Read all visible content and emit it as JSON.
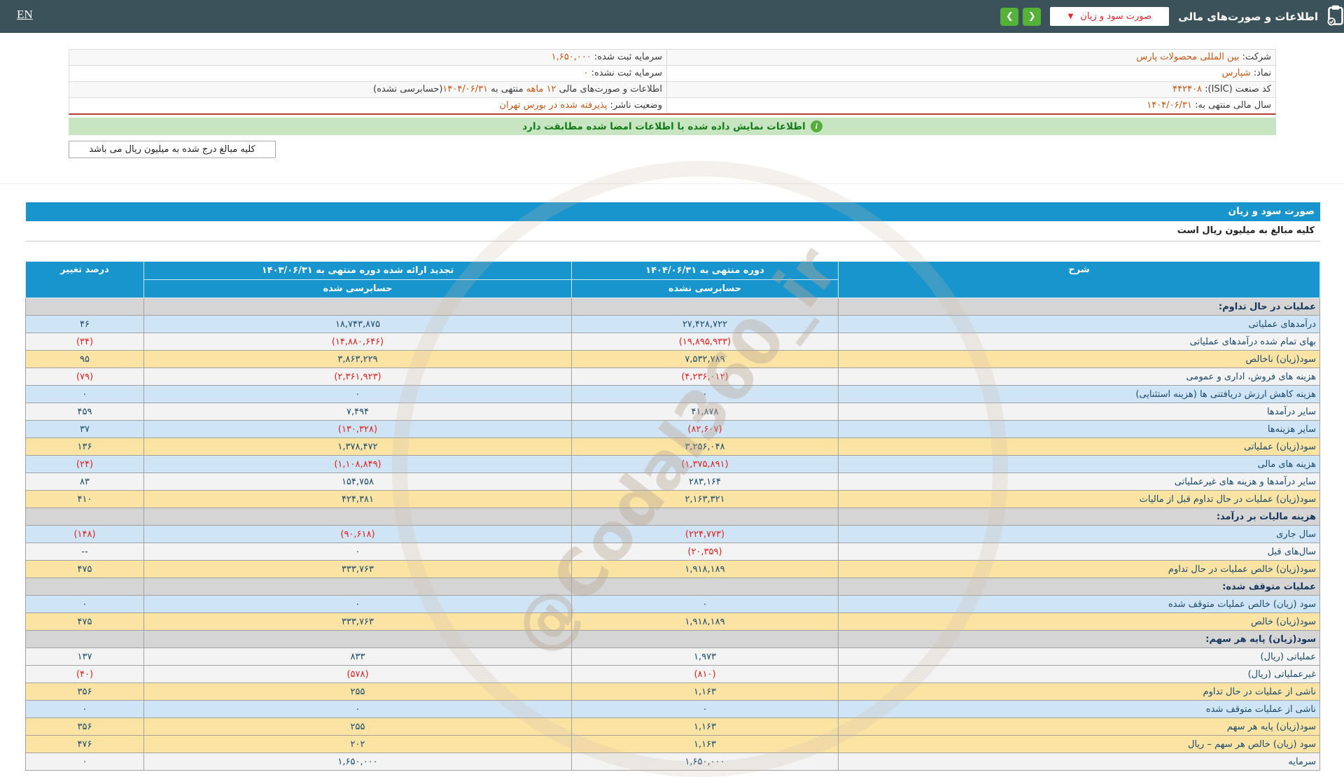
{
  "topbar": {
    "en": "EN",
    "title": "اطلاعات و صورت‌های مالی",
    "dropdown_value": "صورت سود و زیان",
    "dropdown_arrow": "▼",
    "next_icon": "❯",
    "prev_icon": "❮"
  },
  "company_info": {
    "rows": [
      {
        "right": [
          {
            "type": "label",
            "text": "شرکت: "
          },
          {
            "type": "value",
            "text": "بین المللی محصولات پارس"
          }
        ],
        "left": [
          {
            "type": "label",
            "text": "سرمایه ثبت شده: "
          },
          {
            "type": "value",
            "text": "۱,۶۵۰,۰۰۰"
          }
        ]
      },
      {
        "right": [
          {
            "type": "label",
            "text": "نماد: "
          },
          {
            "type": "value",
            "text": "شپارس"
          }
        ],
        "left": [
          {
            "type": "label",
            "text": "سرمایه ثبت نشده: "
          },
          {
            "type": "value",
            "text": "۰"
          }
        ]
      },
      {
        "right": [
          {
            "type": "label",
            "text": "کد صنعت (ISIC): "
          },
          {
            "type": "value",
            "text": "۴۴۲۴۰۸"
          }
        ],
        "left": [
          {
            "type": "label",
            "text": "اطلاعات و صورت‌های مالی "
          },
          {
            "type": "value",
            "text": "۱۲ ماهه"
          },
          {
            "type": "label",
            "text": " منتهی به "
          },
          {
            "type": "value",
            "text": "۱۴۰۴/۰۶/۳۱"
          },
          {
            "type": "label",
            "text": "(حسابرسی نشده)"
          }
        ]
      },
      {
        "right": [
          {
            "type": "label",
            "text": "سال مالی منتهی به: "
          },
          {
            "type": "value",
            "text": "۱۴۰۴/۰۶/۳۱"
          }
        ],
        "left": [
          {
            "type": "label",
            "text": "وضعیت ناشر: "
          },
          {
            "type": "value",
            "text": "پذیرفته شده در بورس تهران"
          }
        ]
      }
    ]
  },
  "banner": {
    "icon": "i",
    "text": "اطلاعات نمایش داده شده با اطلاعات امضا شده مطابقت دارد"
  },
  "units_note": "کلیه مبالغ درج شده به میلیون ریال می باشد",
  "statement": {
    "title": "صورت سود و زیان",
    "units_line": "کلیه مبالغ به میلیون ریال است",
    "columns": {
      "description": "شرح",
      "period_current": "دوره منتهی به ۱۴۰۴/۰۶/۳۱",
      "period_current_sub": "حسابرسی نشده",
      "period_prior": "تجدید ارائه شده دوره منتهی به ۱۴۰۳/۰۶/۳۱",
      "period_prior_sub": "حسابرسی شده",
      "change": "درصد تغییر"
    },
    "rows": [
      {
        "style": "section",
        "label": "عملیات در حال تداوم:",
        "current": "",
        "prior": "",
        "change": ""
      },
      {
        "style": "blue",
        "label": "درآمدهای عملیاتی",
        "current": "۲۷,۴۲۸,۷۲۲",
        "prior": "۱۸,۷۴۳,۸۷۵",
        "change": "۴۶"
      },
      {
        "style": "plain",
        "label": "بهای تمام شده درآمدهای عملیاتی",
        "current": "(۱۹,۸۹۵,۹۳۳)",
        "prior": "(۱۴,۸۸۰,۶۴۶)",
        "change": "(۳۴)"
      },
      {
        "style": "highlight",
        "label": "سود(زیان) ناخالص",
        "current": "۷,۵۳۲,۷۸۹",
        "prior": "۳,۸۶۳,۲۲۹",
        "change": "۹۵"
      },
      {
        "style": "plain",
        "label": "هزینه های فروش، اداری و عمومی",
        "current": "(۴,۲۳۶,۰۱۲)",
        "prior": "(۲,۳۶۱,۹۲۳)",
        "change": "(۷۹)"
      },
      {
        "style": "blue",
        "label": "هزینه کاهش ارزش دریافتنی ها (هزینه استثنایی)",
        "current": "۰",
        "prior": "۰",
        "change": "۰"
      },
      {
        "style": "plain",
        "label": "سایر درآمدها",
        "current": "۴۱,۸۷۸",
        "prior": "۷,۴۹۴",
        "change": "۴۵۹"
      },
      {
        "style": "blue",
        "label": "سایر هزینه‌ها",
        "current": "(۸۲,۶۰۷)",
        "prior": "(۱۳۰,۳۲۸)",
        "change": "۳۷"
      },
      {
        "style": "highlight",
        "label": "سود(زیان) عملیاتی",
        "current": "۳,۲۵۶,۰۴۸",
        "prior": "۱,۳۷۸,۴۷۲",
        "change": "۱۳۶"
      },
      {
        "style": "blue",
        "label": "هزینه های مالی",
        "current": "(۱,۳۷۵,۸۹۱)",
        "prior": "(۱,۱۰۸,۸۴۹)",
        "change": "(۲۴)"
      },
      {
        "style": "plain",
        "label": "سایر درآمدها و هزینه های غیرعملیاتی",
        "current": "۲۸۳,۱۶۴",
        "prior": "۱۵۴,۷۵۸",
        "change": "۸۳"
      },
      {
        "style": "highlight",
        "label": "سود(زیان) عملیات در حال تداوم قبل از مالیات",
        "current": "۲,۱۶۳,۳۲۱",
        "prior": "۴۲۴,۳۸۱",
        "change": "۴۱۰"
      },
      {
        "style": "section",
        "label": "هزینه مالیات بر درآمد:",
        "current": "",
        "prior": "",
        "change": ""
      },
      {
        "style": "blue",
        "label": "سال جاری",
        "current": "(۲۲۴,۷۷۳)",
        "prior": "(۹۰,۶۱۸)",
        "change": "(۱۴۸)"
      },
      {
        "style": "plain",
        "label": "سال‌های قبل",
        "current": "(۲۰,۳۵۹)",
        "prior": "۰",
        "change": "--"
      },
      {
        "style": "highlight",
        "label": "سود(زیان) خالص عملیات در حال تداوم",
        "current": "۱,۹۱۸,۱۸۹",
        "prior": "۳۳۳,۷۶۳",
        "change": "۴۷۵"
      },
      {
        "style": "section",
        "label": "عملیات متوقف شده:",
        "current": "",
        "prior": "",
        "change": ""
      },
      {
        "style": "blue",
        "label": "سود (زیان) خالص عملیات متوقف شده",
        "current": "۰",
        "prior": "۰",
        "change": "۰"
      },
      {
        "style": "highlight",
        "label": "سود(زیان) خالص",
        "current": "۱,۹۱۸,۱۸۹",
        "prior": "۳۳۳,۷۶۳",
        "change": "۴۷۵"
      },
      {
        "style": "section",
        "label": "سود(زیان) پایه هر سهم:",
        "current": "",
        "prior": "",
        "change": ""
      },
      {
        "style": "plain",
        "label": "عملیاتی (ریال)",
        "current": "۱,۹۷۳",
        "prior": "۸۳۳",
        "change": "۱۳۷"
      },
      {
        "style": "plain",
        "label": "غیرعملیاتی (ریال)",
        "current": "(۸۱۰)",
        "prior": "(۵۷۸)",
        "change": "(۴۰)"
      },
      {
        "style": "highlight",
        "label": "ناشی از عملیات در حال تداوم",
        "current": "۱,۱۶۳",
        "prior": "۲۵۵",
        "change": "۳۵۶"
      },
      {
        "style": "blue",
        "label": "ناشی از عملیات متوقف شده",
        "current": "۰",
        "prior": "۰",
        "change": "۰"
      },
      {
        "style": "highlight",
        "label": "سود(زیان) پایه هر سهم",
        "current": "۱,۱۶۳",
        "prior": "۲۵۵",
        "change": "۳۵۶"
      },
      {
        "style": "highlight",
        "label": "سود (زیان) خالص هر سهم – ریال",
        "current": "۱,۱۶۳",
        "prior": "۲۰۲",
        "change": "۴۷۶"
      },
      {
        "style": "plain",
        "label": "سرمایه",
        "current": "۱,۶۵۰,۰۰۰",
        "prior": "۱,۶۵۰,۰۰۰",
        "change": "۰"
      }
    ]
  },
  "watermark": "@Codal360_ir",
  "colors": {
    "topbar_bg": "#3b525a",
    "button_green": "#56b138",
    "dropdown_text_red": "#e52b2b",
    "accent_blue": "#1895cd",
    "row_blue": "#cfe4f5",
    "row_yellow": "#fbe3a4",
    "row_section_gray": "#d5d5d5",
    "row_plain": "#f3f3f3",
    "negative_red": "#e11f1f",
    "number_navy": "#1b4a6b",
    "info_value_orange": "#c35817",
    "banner_green_bg": "#c7e5c0",
    "banner_green_text": "#157a1c",
    "red_underline": "#b13c30"
  }
}
